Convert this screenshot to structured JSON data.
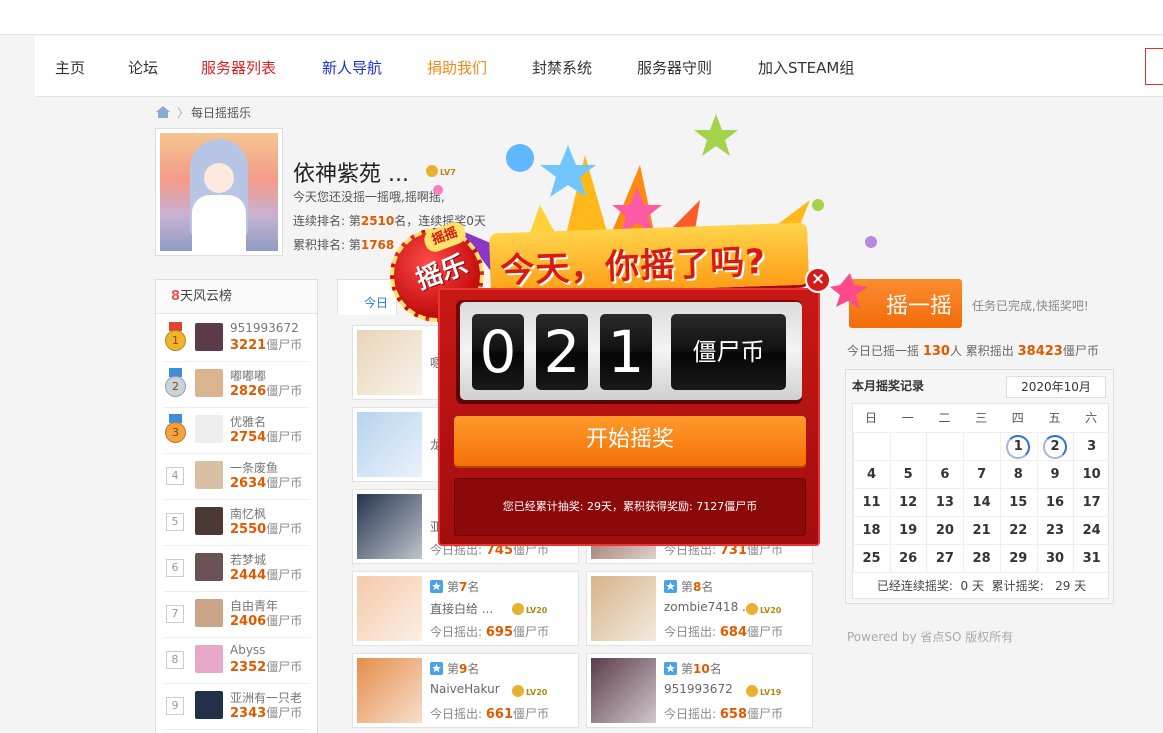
{
  "nav": {
    "items": [
      {
        "label": "主页",
        "color": "#333333"
      },
      {
        "label": "论坛",
        "color": "#333333"
      },
      {
        "label": "服务器列表",
        "color": "#e02020"
      },
      {
        "label": "新人导航",
        "color": "#1a33cc"
      },
      {
        "label": "捐助我们",
        "color": "#f08c1a"
      },
      {
        "label": "封禁系统",
        "color": "#333333"
      },
      {
        "label": "服务器守则",
        "color": "#333333"
      },
      {
        "label": "加入STEAM组",
        "color": "#333333"
      }
    ]
  },
  "breadcrumb": {
    "current": "每日摇摇乐",
    "home_icon": "home-icon",
    "separator": "〉"
  },
  "user": {
    "name": "依神紫苑 ...",
    "level": "LV7",
    "line1": "今天您还没摇一摇哦,摇啊摇,",
    "streak_rank_label": "连续排名: 第",
    "streak_rank": "2510",
    "streak_rank_suffix": "名，连续摇奖0天",
    "total_rank_label": "累积排名: 第",
    "total_rank": "1768"
  },
  "ranking": {
    "title_num": "8",
    "title_text": "天风云榜",
    "unit": "僵尸币",
    "items": [
      {
        "no": "1",
        "name": "951993672",
        "coins": "3221",
        "medal": "#f1b22c",
        "ribbon": "#e2452c",
        "av": "#5b3d4a"
      },
      {
        "no": "2",
        "name": "嘟嘟嘟",
        "coins": "2826",
        "medal": "#c9d3dd",
        "ribbon": "#3b8fd9",
        "av": "#d9b48e"
      },
      {
        "no": "3",
        "name": "优雅名",
        "coins": "2754",
        "medal": "#f3a23f",
        "ribbon": "#3b8fd9",
        "av": "#eeeeee"
      },
      {
        "no": "4",
        "name": "一条废鱼",
        "coins": "2634",
        "av": "#d9c0a5"
      },
      {
        "no": "5",
        "name": "南忆枫",
        "coins": "2550",
        "av": "#4a3a33"
      },
      {
        "no": "6",
        "name": "若梦城",
        "coins": "2444",
        "av": "#6a5255"
      },
      {
        "no": "7",
        "name": "自由青年",
        "coins": "2406",
        "av": "#caa58a"
      },
      {
        "no": "8",
        "name": "Abyss",
        "coins": "2352",
        "av": "#e8a8c8"
      },
      {
        "no": "9",
        "name": "亚洲有一只老",
        "coins": "2343",
        "av": "#23304a"
      }
    ]
  },
  "today": {
    "tab_label": "今日",
    "rank_prefix": "第",
    "rank_suffix": "名",
    "coins_label": "今日摇出: ",
    "unit": "僵尸币",
    "cards": [
      {
        "rank": "",
        "name": "嗯",
        "coins": "",
        "lv": "",
        "col": "#e9d4b8"
      },
      {
        "rank": "",
        "name": "",
        "coins": "",
        "lv": "",
        "col": "#ffd9a3"
      },
      {
        "rank": "",
        "name": "龙",
        "coins": "",
        "lv": "",
        "col": "#b7d3ef"
      },
      {
        "rank": "",
        "name": "",
        "coins": "",
        "lv": "",
        "col": "#f2c9d8"
      },
      {
        "rank": "",
        "name": "亚",
        "coins": "745",
        "lv": "",
        "col": "#24344f"
      },
      {
        "rank": "",
        "name": "",
        "coins": "731",
        "lv": "",
        "col": "#8b5a4b"
      },
      {
        "rank": "7",
        "name": "直接白给 ...",
        "coins": "695",
        "lv": "LV20",
        "col": "#f4c9a8"
      },
      {
        "rank": "8",
        "name": "zombie7418 ...",
        "coins": "684",
        "lv": "LV20",
        "col": "#d6b48a"
      },
      {
        "rank": "9",
        "name": "NaiveHakur",
        "coins": "661",
        "lv": "LV20",
        "col": "#e58d4c"
      },
      {
        "rank": "10",
        "name": "951993672",
        "coins": "658",
        "lv": "LV19",
        "col": "#5b3d4a"
      }
    ]
  },
  "side": {
    "shake_label": "摇一摇",
    "task_note": "任务已完成,快摇奖吧!",
    "today_prefix": "今日已摇一摇 ",
    "today_count": "130",
    "today_mid": "人 累积摇出 ",
    "today_total": "38423",
    "today_unit": "僵尸币"
  },
  "calendar": {
    "title": "本月摇奖记录",
    "month": "2020年10月",
    "weekdays": [
      "日",
      "一",
      "二",
      "三",
      "四",
      "五",
      "六"
    ],
    "first_weekday": 4,
    "days_in_month": 31,
    "done_days": [
      1,
      2
    ],
    "footer": "已经连续摇奖:  0 天  累计摇奖:   29 天"
  },
  "powered": "Powered by 省点SO 版权所有",
  "popup": {
    "badge_top": "摇摇",
    "badge_text": "摇乐",
    "banner": "今天，你摇了吗?",
    "digits": [
      "0",
      "2",
      "1"
    ],
    "unit": "僵尸币",
    "start_label": "开始摇奖",
    "message": "您已经累计抽奖: 29天，累积获得奖励: 7127僵尸币",
    "close_symbol": "×"
  },
  "colors": {
    "accent_orange": "#f57007",
    "coin_orange": "#e05a00",
    "modal_red": "#c81816"
  }
}
